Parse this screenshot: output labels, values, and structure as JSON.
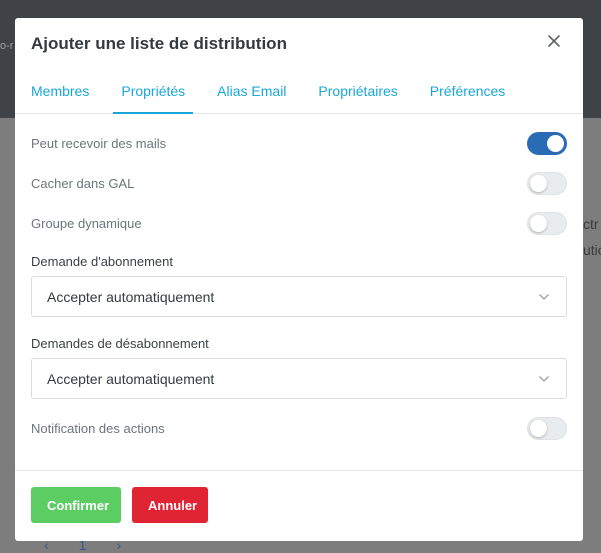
{
  "background": {
    "top_fragment": "o-r",
    "right_fragment_1": "ctr",
    "right_fragment_2": "utio",
    "pager_prev": "‹",
    "pager_page": "1",
    "pager_next": "›"
  },
  "modal": {
    "title": "Ajouter une liste de distribution",
    "close_icon": "close-icon",
    "tabs": [
      {
        "label": "Membres",
        "active": false
      },
      {
        "label": "Propriétés",
        "active": true
      },
      {
        "label": "Alias Email",
        "active": false
      },
      {
        "label": "Propriétaires",
        "active": false
      },
      {
        "label": "Préférences",
        "active": false
      }
    ],
    "properties": {
      "can_receive": {
        "label": "Peut recevoir des mails",
        "enabled": true
      },
      "hide_gal": {
        "label": "Cacher dans GAL",
        "enabled": false
      },
      "dynamic_group": {
        "label": "Groupe dynamique",
        "enabled": false
      },
      "subscribe": {
        "label": "Demande d'abonnement",
        "value": "Accepter automatiquement"
      },
      "unsubscribe": {
        "label": "Demandes de désabonnement",
        "value": "Accepter automatiquement"
      },
      "notify": {
        "label": "Notification des actions",
        "enabled": false
      }
    },
    "footer": {
      "confirm_label": "Confirmer",
      "cancel_label": "Annuler"
    }
  },
  "colors": {
    "accent": "#1aa7d8",
    "toggle_on": "#2a6bb5",
    "confirm": "#5ccd63",
    "cancel": "#e02434"
  }
}
